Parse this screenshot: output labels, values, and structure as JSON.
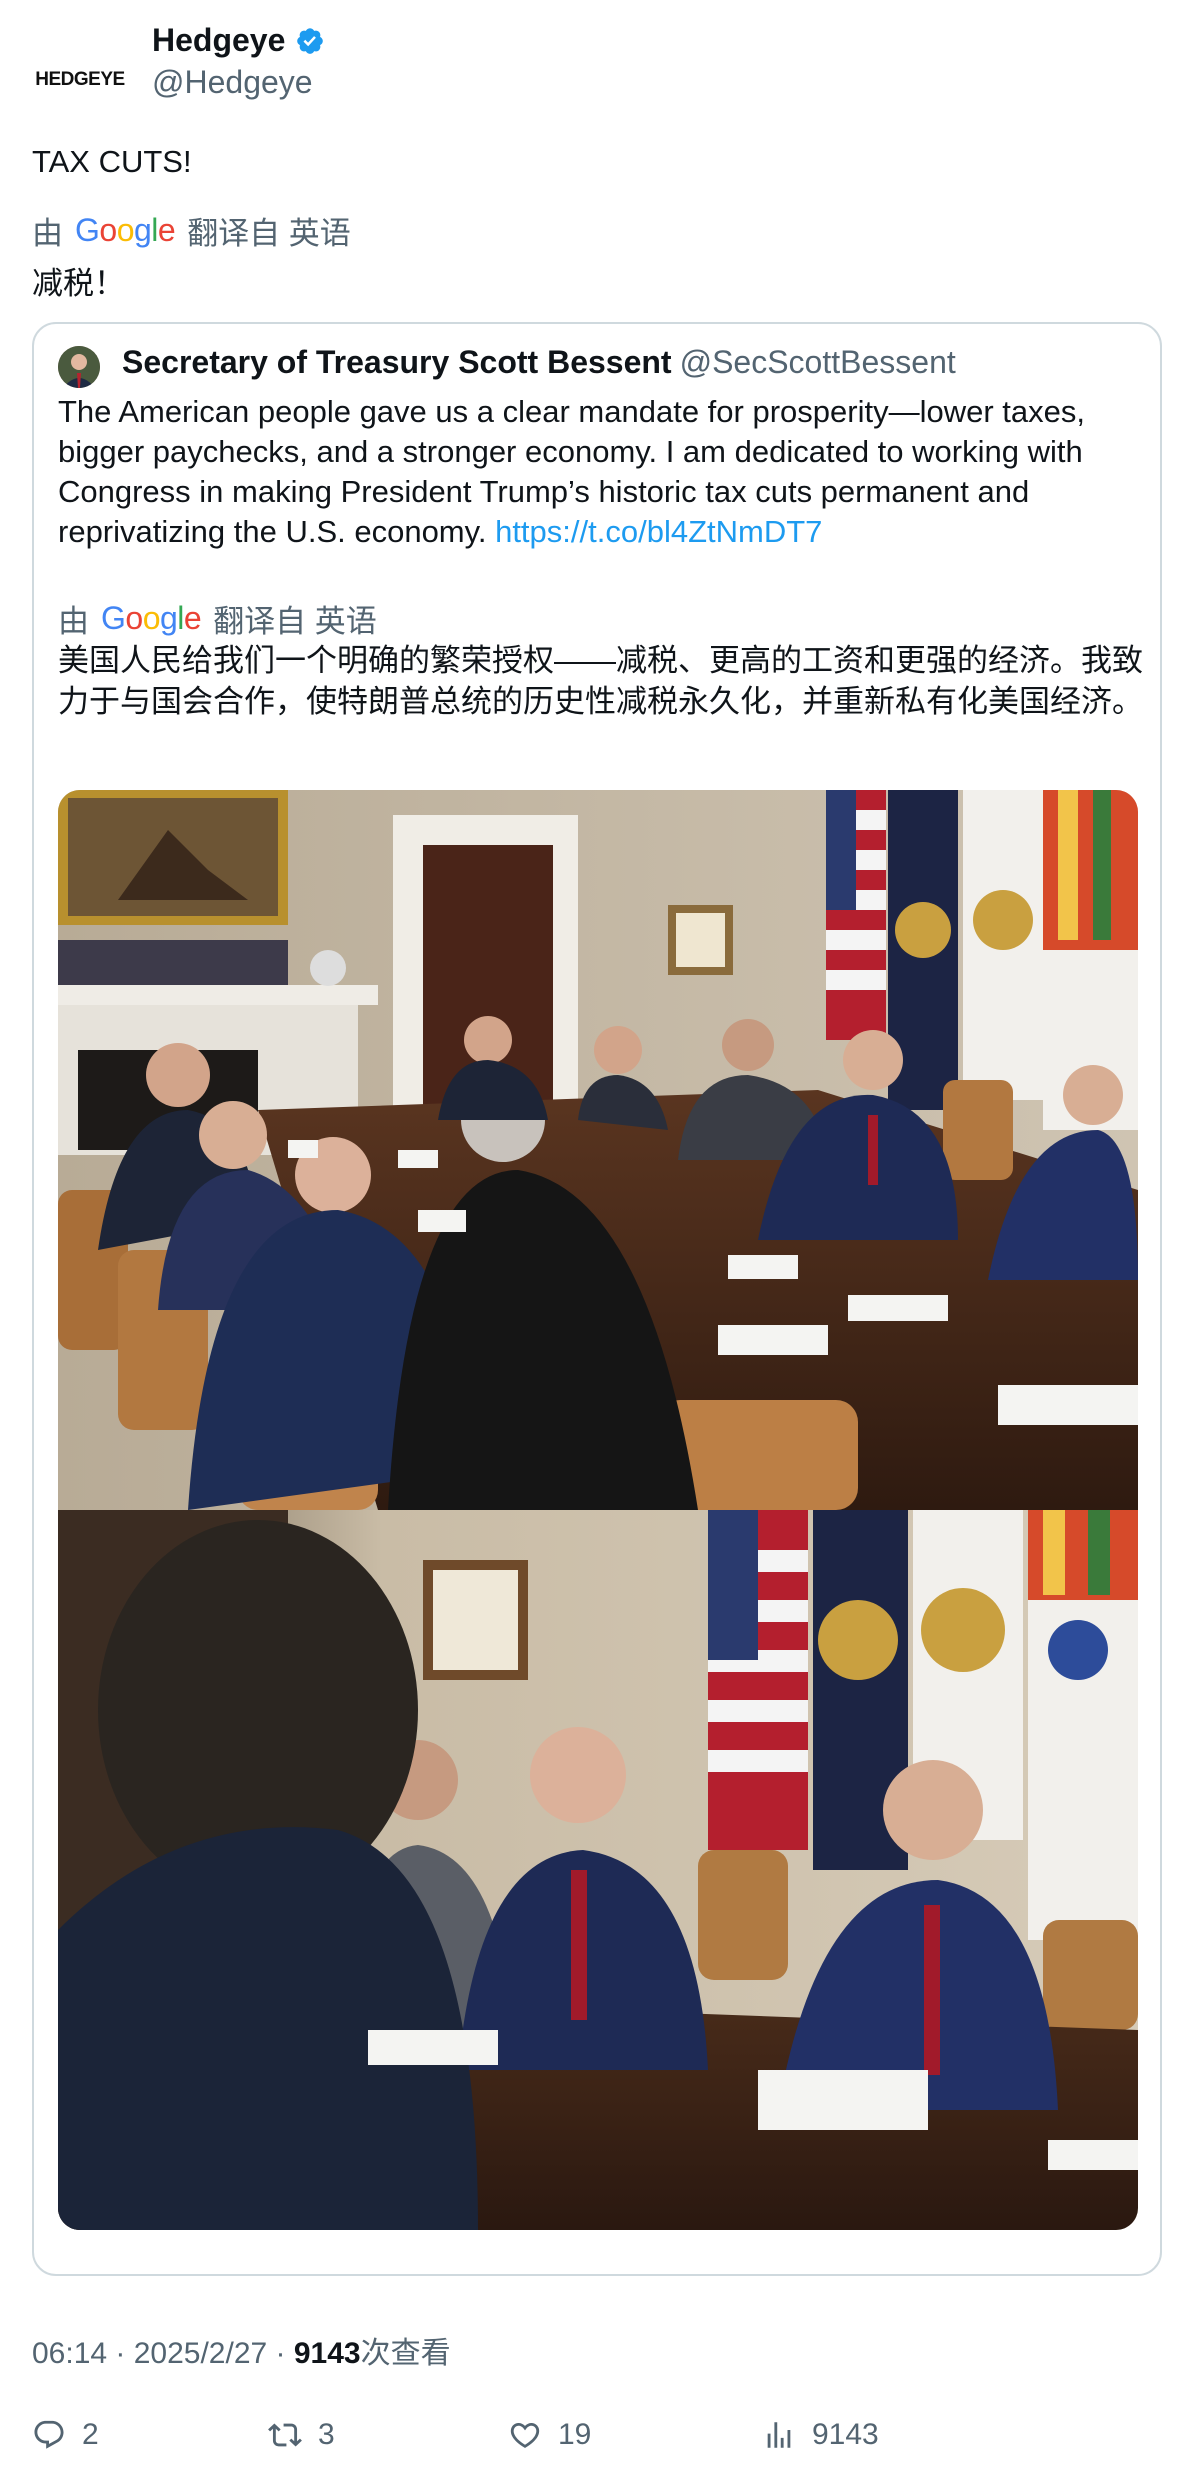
{
  "author": {
    "avatar_text": "HEDGEYE",
    "name": "Hedgeye",
    "handle": "@Hedgeye"
  },
  "tweet": {
    "text": "TAX CUTS!",
    "translate": {
      "prefix": "由",
      "provider": "Google",
      "suffix": "翻译自 英语"
    },
    "translated_text": "减税！"
  },
  "quote": {
    "name": "Secretary of Treasury Scott Bessent",
    "handle": "@SecScottBessent",
    "text": "The American people gave us a clear mandate for prosperity—lower taxes, bigger paychecks, and a stronger economy. I am dedicated to working with Congress in making President Trump’s historic tax cuts permanent and reprivatizing the U.S. economy.",
    "link": "https://t.co/bl4ZtNmDT7",
    "translate": {
      "prefix": "由",
      "provider": "Google",
      "suffix": "翻译自 英语"
    },
    "translated_text": "美国人民给我们一个明确的繁荣授权——减税、更高的工资和更强的经济。我致力于与国会合作，使特朗普总统的历史性减税永久化，并重新私有化美国经济。"
  },
  "meta": {
    "time": "06:14 · 2025/2/27 · ",
    "views": "9143",
    "views_suffix": "次查看"
  },
  "actions": {
    "replies": "2",
    "retweets": "3",
    "likes": "19",
    "views": "9143"
  },
  "colors": {
    "link": "#1d9bf0",
    "verified": "#1d9bf0",
    "secondary_text": "#536471"
  }
}
